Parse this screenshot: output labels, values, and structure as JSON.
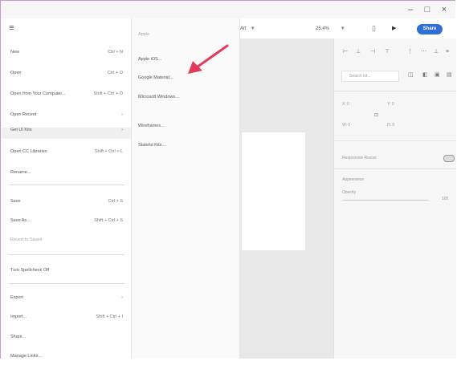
{
  "window": {
    "minimize": "–",
    "maximize": "□",
    "close": "×"
  },
  "menu": {
    "hamburger": "≡",
    "items": [
      {
        "label": "New",
        "shortcut": "Ctrl + N"
      },
      {
        "label": "Open",
        "shortcut": "Ctrl + O"
      },
      {
        "label": "Open from Your Computer...",
        "shortcut": "Shift + Ctrl + O"
      },
      {
        "label": "Open Recent",
        "shortcut": "›"
      },
      {
        "label": "Get UI Kits",
        "shortcut": "›"
      },
      {
        "label": "Open CC Libraries",
        "shortcut": "Shift + Ctrl + L"
      },
      {
        "label": "Rename..."
      },
      {
        "label": "Save",
        "shortcut": "Ctrl + S"
      },
      {
        "label": "Save As...",
        "shortcut": "Shift + Ctrl + S"
      },
      {
        "label": "Revert to Saved"
      },
      {
        "label": "Turn Spellcheck Off"
      },
      {
        "label": "Export",
        "shortcut": "›"
      },
      {
        "label": "Import...",
        "shortcut": "Shift + Ctrl + I"
      },
      {
        "label": "Share..."
      },
      {
        "label": "Manage Links..."
      }
    ]
  },
  "submenu": {
    "header": "Apple",
    "items": [
      "Apple iOS...",
      "Google Material...",
      "Microsoft Windows...",
      "Wireframes...",
      "Stateful Kits..."
    ]
  },
  "toolbar": {
    "zoom_prefix": "Art",
    "zoom": "25.4%",
    "share": "Share"
  },
  "inspector": {
    "search": "Search kit...",
    "x": "X: 0",
    "y": "Y: 0",
    "w": "W: 0",
    "h": "H: 0",
    "responsive": "Responsive Resize",
    "appearance": "Appearance",
    "opacity": "Opacity",
    "opacity_value": "100"
  },
  "colors": {
    "accent": "#2f6fd6",
    "arrow": "#e33a5a",
    "canvas": "#e8e8e8"
  }
}
